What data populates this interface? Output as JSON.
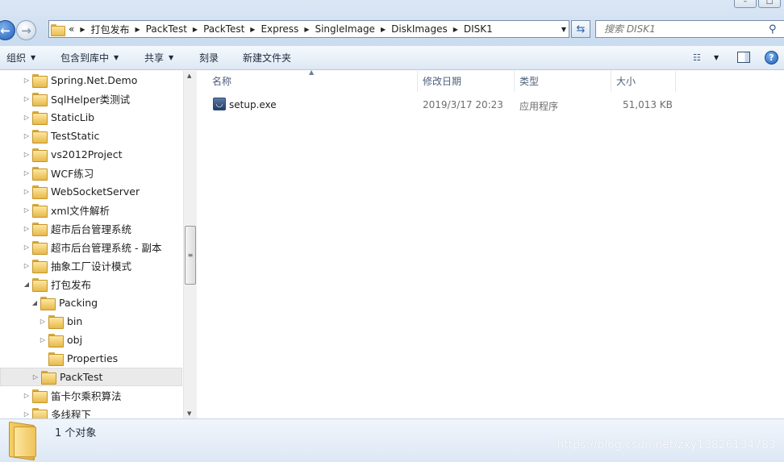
{
  "window": {
    "controls": [
      "–",
      "□"
    ]
  },
  "address_bar": {
    "overflow_marker": "«",
    "crumbs": [
      "打包发布",
      "PackTest",
      "PackTest",
      "Express",
      "SingleImage",
      "DiskImages",
      "DISK1"
    ]
  },
  "search": {
    "placeholder": "搜索 DISK1"
  },
  "toolbar": {
    "organize": "组织",
    "include_in_library": "包含到库中",
    "share": "共享",
    "burn": "刻录",
    "new_folder": "新建文件夹"
  },
  "nav_tree": [
    {
      "label": "Spring.Net.Demo",
      "level": 0,
      "expander": "▷"
    },
    {
      "label": "SqlHelper类测试",
      "level": 0,
      "expander": "▷"
    },
    {
      "label": "StaticLib",
      "level": 0,
      "expander": "▷"
    },
    {
      "label": "TestStatic",
      "level": 0,
      "expander": "▷"
    },
    {
      "label": "vs2012Project",
      "level": 0,
      "expander": "▷"
    },
    {
      "label": "WCF练习",
      "level": 0,
      "expander": "▷"
    },
    {
      "label": "WebSocketServer",
      "level": 0,
      "expander": "▷"
    },
    {
      "label": "xml文件解析",
      "level": 0,
      "expander": "▷"
    },
    {
      "label": "超市后台管理系统",
      "level": 0,
      "expander": "▷"
    },
    {
      "label": "超市后台管理系统 - 副本",
      "level": 0,
      "expander": "▷"
    },
    {
      "label": "抽象工厂设计模式",
      "level": 0,
      "expander": "▷"
    },
    {
      "label": "打包发布",
      "level": 0,
      "expander": "◢"
    },
    {
      "label": "Packing",
      "level": 1,
      "expander": "◢"
    },
    {
      "label": "bin",
      "level": 2,
      "expander": "▷"
    },
    {
      "label": "obj",
      "level": 2,
      "expander": "▷"
    },
    {
      "label": "Properties",
      "level": 2,
      "expander": ""
    },
    {
      "label": "PackTest",
      "level": 1,
      "expander": "▷",
      "selected": true
    },
    {
      "label": "笛卡尔乘积算法",
      "level": 0,
      "expander": "▷"
    },
    {
      "label": "多线程下",
      "level": 0,
      "expander": "▷"
    }
  ],
  "columns": {
    "name": "名称",
    "modified": "修改日期",
    "type": "类型",
    "size": "大小"
  },
  "files": [
    {
      "name": "setup.exe",
      "modified": "2019/3/17 20:23",
      "type": "应用程序",
      "size": "51,013 KB",
      "icon": "exe-icon"
    }
  ],
  "status": {
    "item_count": "1 个对象"
  },
  "watermark": "https://blog.csdn.net/zxy13826134783",
  "colors": {
    "chrome": "#d4e2f2",
    "selection": "#eaeaea",
    "folder": "#f2c75a"
  }
}
